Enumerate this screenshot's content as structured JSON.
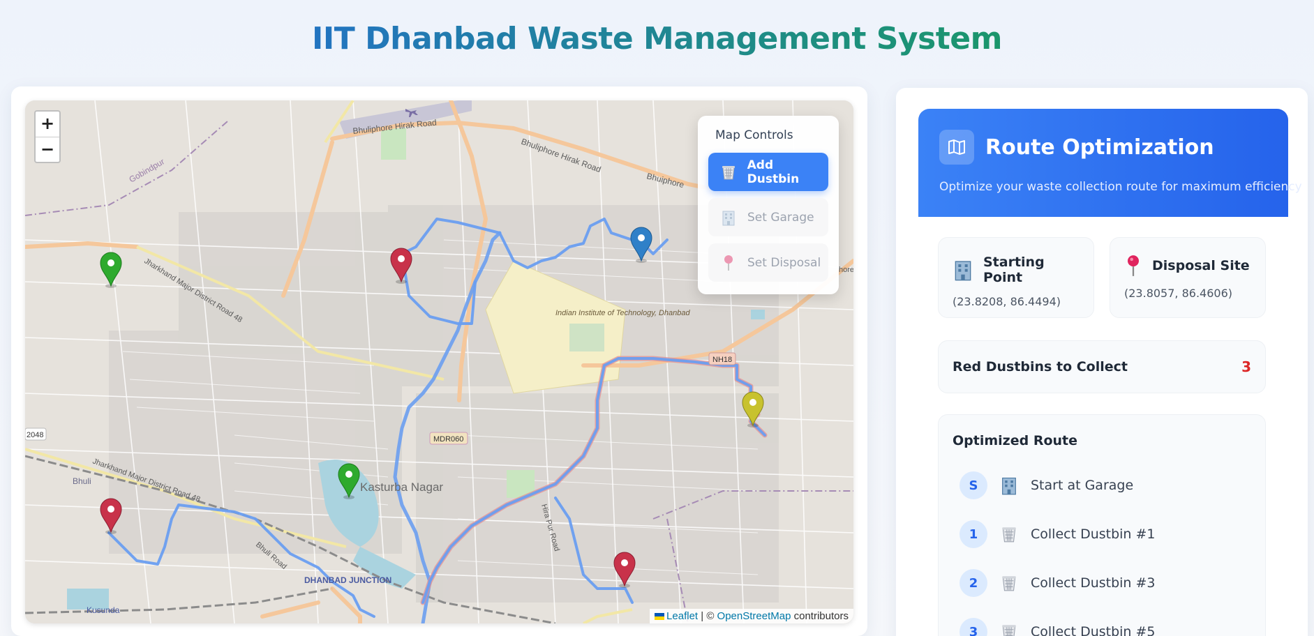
{
  "page": {
    "title": "IIT Dhanbad Waste Management System"
  },
  "map": {
    "zoom_in": "+",
    "zoom_out": "−",
    "attribution": {
      "leaflet": "Leaflet",
      "separator": " | © ",
      "osm": "OpenStreetMap",
      "suffix": " contributors"
    },
    "labels": {
      "road1": "Bhuliphore Hirak Road",
      "road2": "Bhuliphore Hirak Road",
      "road3": "Bhuiphore",
      "gobindpur": "Gobindpur",
      "district_road_top": "Jharkhand Major District Road 48",
      "district_road_bottom": "Jharkhand Major District Road 48",
      "iit": "Indian Institute of Technology, Dhanbad",
      "nh18": "NH18",
      "mdr060": "MDR060",
      "kasturba": "Kasturba Nagar",
      "bhuli": "Bhuli",
      "bhuli_road": "Bhuli Road",
      "junction": "DHANBAD JUNCTION",
      "kusunda": "Kusunda",
      "r2048": "2048",
      "hira_pur": "Hira Pur Road",
      "hore": "hore"
    }
  },
  "controls": {
    "title": "Map Controls",
    "buttons": [
      {
        "label": "Add Dustbin",
        "active": true,
        "icon": "wastebasket-icon"
      },
      {
        "label": "Set Garage",
        "active": false,
        "icon": "building-icon"
      },
      {
        "label": "Set Disposal",
        "active": false,
        "icon": "pushpin-icon"
      }
    ]
  },
  "route": {
    "title": "Route Optimization",
    "subtitle": "Optimize your waste collection route for maximum efficiency",
    "starting_point": {
      "label": "Starting Point",
      "value": "(23.8208, 86.4494)"
    },
    "disposal_site": {
      "label": "Disposal Site",
      "value": "(23.8057, 86.4606)"
    },
    "red_count": {
      "label": "Red Dustbins to Collect",
      "value": "3"
    },
    "optimized_title": "Optimized Route",
    "steps": [
      {
        "badge": "S",
        "label": "Start at Garage",
        "icon": "building-icon"
      },
      {
        "badge": "1",
        "label": "Collect Dustbin #1",
        "icon": "wastebasket-icon"
      },
      {
        "badge": "2",
        "label": "Collect Dustbin #3",
        "icon": "wastebasket-icon"
      },
      {
        "badge": "3",
        "label": "Collect Dustbin #5",
        "icon": "wastebasket-icon"
      }
    ]
  },
  "colors": {
    "marker_red": "#c8324a",
    "marker_green": "#2eaa2e",
    "marker_blue": "#2f80c8",
    "marker_yellow": "#c8c22e",
    "route_line": "#6a9ef0",
    "accent": "#3b82f6"
  }
}
